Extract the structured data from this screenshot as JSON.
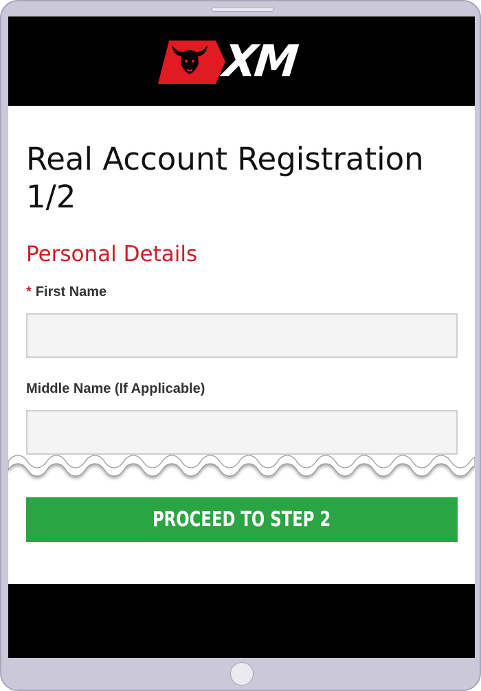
{
  "brand": {
    "logo_text": "XM",
    "colors": {
      "red": "#e11b22",
      "black": "#000000",
      "white": "#ffffff"
    }
  },
  "page": {
    "title": "Real Account Registration 1/2"
  },
  "form": {
    "section_title": "Personal Details",
    "required_marker": "*",
    "first_name_label": "First Name",
    "first_name_value": "",
    "middle_name_label": "Middle Name (If Applicable)",
    "middle_name_value": ""
  },
  "actions": {
    "proceed_label": "PROCEED TO STEP 2",
    "proceed_color": "#2ba543"
  },
  "colors": {
    "accent_red": "#cf1c25",
    "device_frame": "#cbc8da",
    "input_bg": "#f4f4f4"
  }
}
